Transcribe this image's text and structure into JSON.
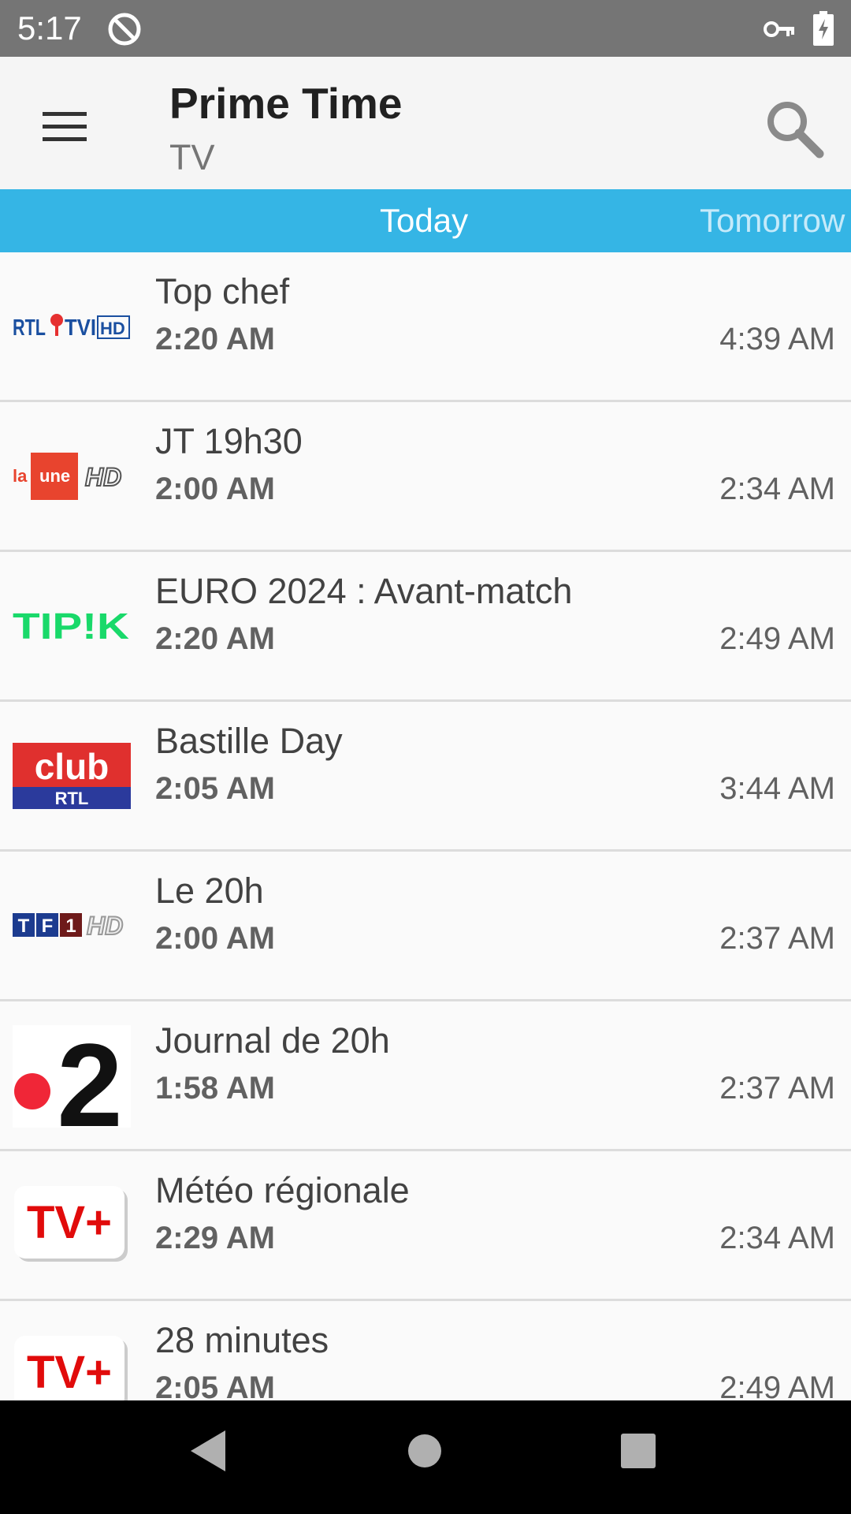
{
  "status_bar": {
    "time": "5:17"
  },
  "app_bar": {
    "title": "Prime Time",
    "subtitle": "TV"
  },
  "tabs": [
    {
      "label": "Today"
    },
    {
      "label": "Tomorrow"
    }
  ],
  "programs": [
    {
      "channel": "RTL TVI HD",
      "title": "Top chef",
      "start": "2:20 AM",
      "end": "4:39 AM"
    },
    {
      "channel": "La Une HD",
      "title": "JT 19h30",
      "start": "2:00 AM",
      "end": "2:34 AM"
    },
    {
      "channel": "Tipik",
      "title": "EURO 2024 : Avant-match",
      "start": "2:20 AM",
      "end": "2:49 AM"
    },
    {
      "channel": "Club RTL",
      "title": "Bastille Day",
      "start": "2:05 AM",
      "end": "3:44 AM"
    },
    {
      "channel": "TF1 HD",
      "title": "Le 20h",
      "start": "2:00 AM",
      "end": "2:37 AM"
    },
    {
      "channel": "France 2",
      "title": "Journal de 20h",
      "start": "1:58 AM",
      "end": "2:37 AM"
    },
    {
      "channel": "TV+",
      "title": "Météo régionale",
      "start": "2:29 AM",
      "end": "2:34 AM"
    },
    {
      "channel": "TV+",
      "title": "28 minutes",
      "start": "2:05 AM",
      "end": "2:49 AM"
    }
  ],
  "logos": {
    "rtl_tvi": {
      "text_rtl": "RTL",
      "text_tvi": "TVI",
      "text_hd": "HD"
    },
    "la_une": {
      "text_la": "la",
      "text_une": "une",
      "text_hd": "HD"
    },
    "tipik": {
      "text": "TIP!K"
    },
    "club_rtl": {
      "text_club": "club",
      "text_rtl": "RTL"
    },
    "tf1": {
      "text_t": "T",
      "text_f": "F",
      "text_1": "1",
      "text_hd": "HD"
    },
    "france2": {
      "text": "2"
    },
    "tvplus": {
      "text": "TV+"
    }
  },
  "colors": {
    "status_bar": "#757575",
    "app_bar": "#f5f5f5",
    "tab_bar": "#35b5e5",
    "tab_active_text": "#ffffff",
    "tab_inactive_text": "#c5eafa"
  },
  "icons": {
    "menu": "hamburger-icon",
    "search": "search-icon",
    "back": "back-triangle-icon",
    "home": "home-circle-icon",
    "recents": "recents-square-icon"
  }
}
